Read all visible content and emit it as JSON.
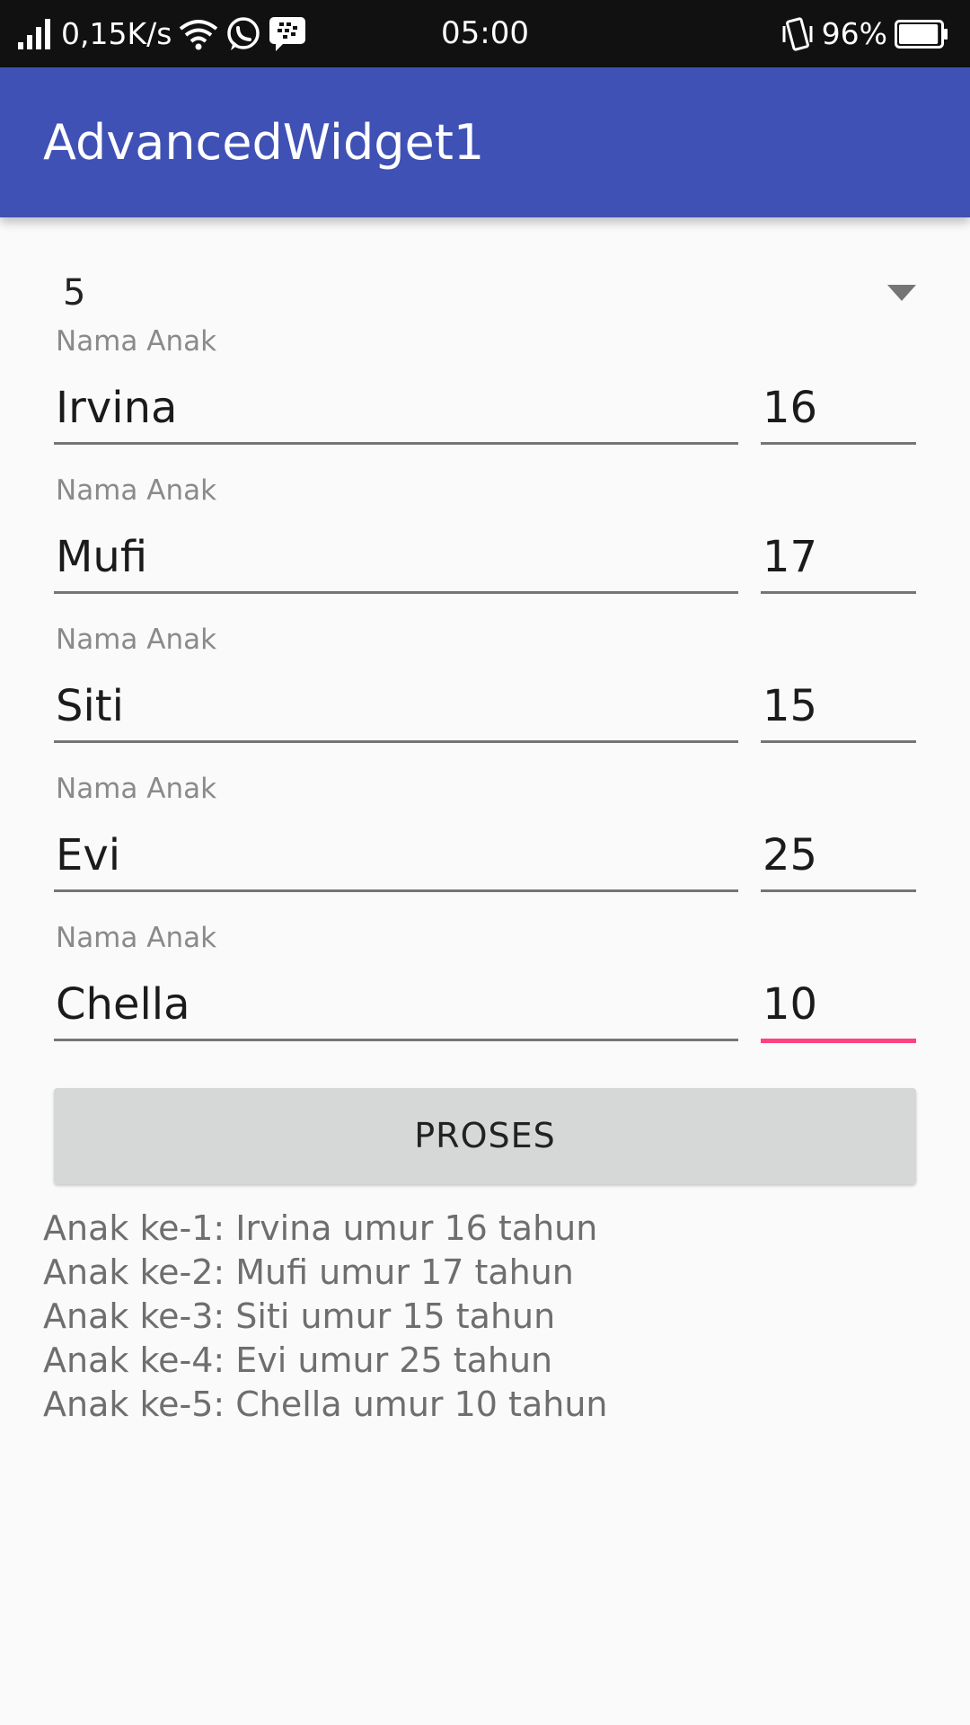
{
  "status_bar": {
    "network_speed": "0,15K/s",
    "time": "05:00",
    "battery_percent": "96%",
    "battery_level": 0.96,
    "icons": [
      "signal-icon",
      "wifi-icon",
      "whatsapp-icon",
      "bbm-icon",
      "vibrate-icon",
      "battery-icon"
    ]
  },
  "app_bar": {
    "title": "AdvancedWidget1",
    "color": "#3f51b5"
  },
  "spinner": {
    "selected": "5"
  },
  "children": [
    {
      "hint": "Nama Anak",
      "name": "Irvina",
      "age": "16"
    },
    {
      "hint": "Nama Anak",
      "name": "Mufi",
      "age": "17"
    },
    {
      "hint": "Nama Anak",
      "name": "Siti",
      "age": "15"
    },
    {
      "hint": "Nama Anak",
      "name": "Evi",
      "age": "25"
    },
    {
      "hint": "Nama Anak",
      "name": "Chella",
      "age": "10"
    }
  ],
  "focused_field": "children.4.age",
  "accent_color": "#ff4081",
  "button": {
    "label": "PROSES"
  },
  "results": [
    "Anak ke-1: Irvina umur 16 tahun",
    "Anak ke-2: Mufi umur 17 tahun",
    "Anak ke-3: Siti umur 15 tahun",
    "Anak ke-4: Evi umur 25 tahun",
    "Anak ke-5: Chella umur 10 tahun"
  ]
}
